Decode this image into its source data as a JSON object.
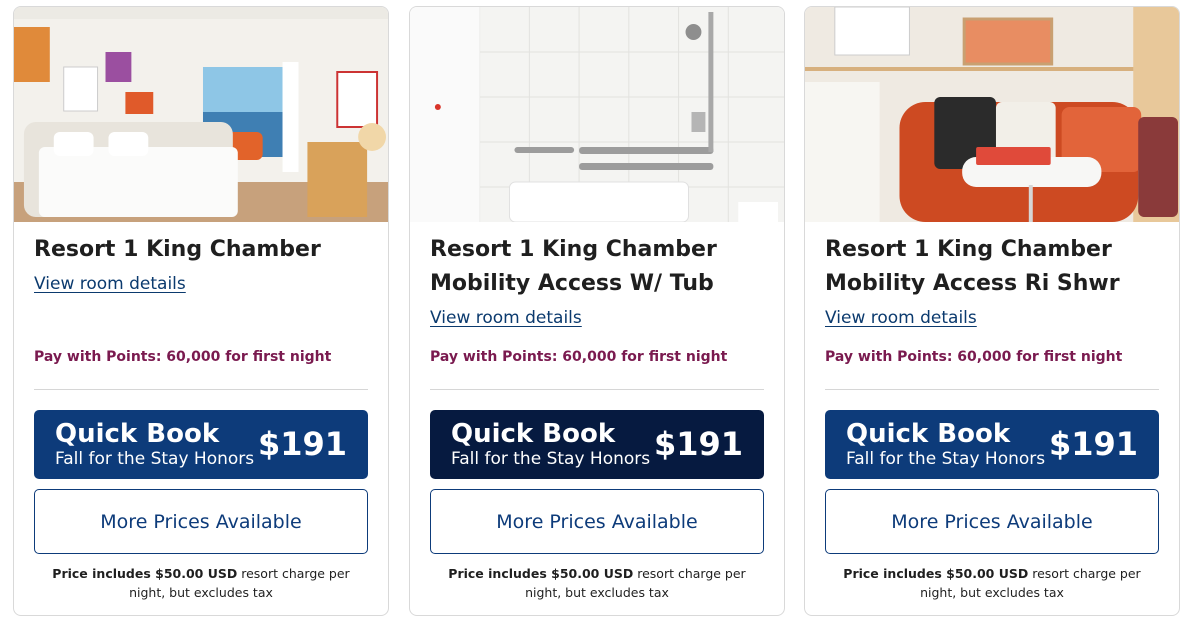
{
  "rooms": [
    {
      "title": "Resort 1 King Chamber",
      "view_details": "View room details",
      "points_text": "Pay with Points: 60,000 for first night",
      "quick_book_label": "Quick Book",
      "quick_book_rate": "Fall for the Stay Honors",
      "price": "$191",
      "more_prices": "More Prices Available",
      "note_bold": "Price includes $50.00 USD",
      "note_rest": " resort charge per night, but excludes tax"
    },
    {
      "title": "Resort 1 King Chamber Mobility Access W/ Tub",
      "view_details": "View room details",
      "points_text": "Pay with Points: 60,000 for first night",
      "quick_book_label": "Quick Book",
      "quick_book_rate": "Fall for the Stay Honors",
      "price": "$191",
      "more_prices": "More Prices Available",
      "note_bold": "Price includes $50.00 USD",
      "note_rest": " resort charge per night, but excludes tax"
    },
    {
      "title": "Resort 1 King Chamber Mobility Access Ri Shwr",
      "view_details": "View room details",
      "points_text": "Pay with Points: 60,000 for first night",
      "quick_book_label": "Quick Book",
      "quick_book_rate": "Fall for the Stay Honors",
      "price": "$191",
      "more_prices": "More Prices Available",
      "note_bold": "Price includes $50.00 USD",
      "note_rest": " resort charge per night, but excludes tax"
    }
  ],
  "colors": {
    "brand_blue": "#0d3b7a",
    "dark_navy": "#061a40",
    "points_magenta": "#7a1a4f",
    "link_blue": "#0b3a6e"
  }
}
